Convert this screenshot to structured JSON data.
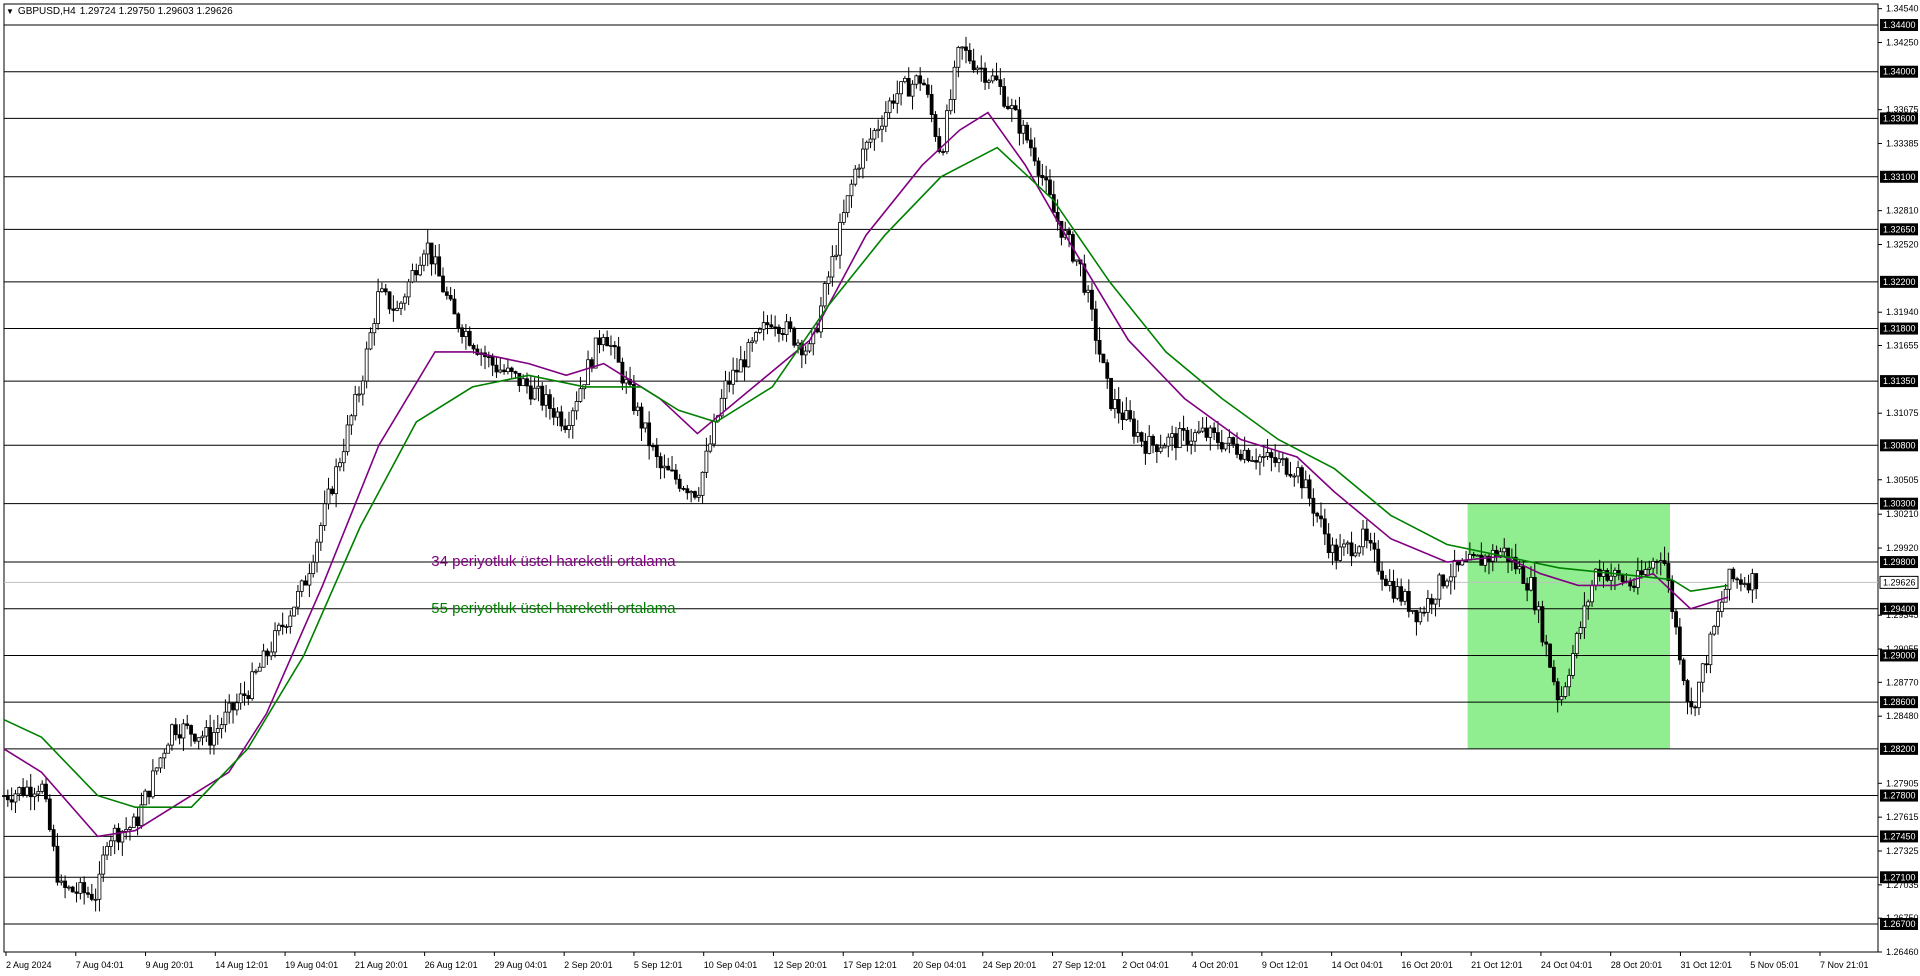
{
  "header": {
    "symbol": "GBPUSD,H4",
    "ohlc": "1.29724 1.29750 1.29603 1.29626"
  },
  "chart_data": {
    "type": "candlestick",
    "ylim": [
      1.2646,
      1.3458
    ],
    "y_ticks": [
      "1.34540",
      "1.34250",
      "1.33675",
      "1.33385",
      "1.32810",
      "1.32520",
      "1.31940",
      "1.31655",
      "1.31075",
      "1.30505",
      "1.30210",
      "1.29920",
      "1.29345",
      "1.29055",
      "1.28770",
      "1.28480",
      "1.27905",
      "1.27615",
      "1.27325",
      "1.27035",
      "1.26750",
      "1.26460"
    ],
    "levels": [
      1.344,
      1.34,
      1.336,
      1.331,
      1.3265,
      1.322,
      1.318,
      1.3135,
      1.308,
      1.303,
      1.298,
      1.294,
      1.29,
      1.286,
      1.282,
      1.278,
      1.2745,
      1.271,
      1.267
    ],
    "level_labels": [
      "1.34400",
      "1.34000",
      "1.33600",
      "1.33100",
      "1.32650",
      "1.32200",
      "1.31800",
      "1.31350",
      "1.30800",
      "1.30300",
      "1.29800",
      "1.29400",
      "1.29000",
      "1.28600",
      "1.28200",
      "1.27800",
      "1.27450",
      "1.27100",
      "1.26700"
    ],
    "current_price": 1.29626,
    "current_price_label": "1.29626",
    "x_labels": [
      "2 Aug 2024",
      "7 Aug 04:01",
      "9 Aug 20:01",
      "14 Aug 12:01",
      "19 Aug 04:01",
      "21 Aug 20:01",
      "26 Aug 12:01",
      "29 Aug 04:01",
      "2 Sep 20:01",
      "5 Sep 12:01",
      "10 Sep 04:01",
      "12 Sep 20:01",
      "17 Sep 12:01",
      "20 Sep 04:01",
      "24 Sep 20:01",
      "27 Sep 12:01",
      "2 Oct 04:01",
      "4 Oct 20:01",
      "9 Oct 12:01",
      "14 Oct 04:01",
      "16 Oct 20:01",
      "21 Oct 12:01",
      "24 Oct 04:01",
      "28 Oct 20:01",
      "31 Oct 12:01",
      "5 Nov 05:01",
      "7 Nov 21:01"
    ],
    "price_path": [
      [
        0,
        1.278
      ],
      [
        0.02,
        1.279
      ],
      [
        0.03,
        1.27
      ],
      [
        0.05,
        1.2695
      ],
      [
        0.055,
        1.2745
      ],
      [
        0.07,
        1.2755
      ],
      [
        0.09,
        1.284
      ],
      [
        0.11,
        1.283
      ],
      [
        0.13,
        1.287
      ],
      [
        0.16,
        1.296
      ],
      [
        0.19,
        1.313
      ],
      [
        0.2,
        1.321
      ],
      [
        0.21,
        1.3195
      ],
      [
        0.225,
        1.3255
      ],
      [
        0.24,
        1.319
      ],
      [
        0.26,
        1.315
      ],
      [
        0.28,
        1.313
      ],
      [
        0.3,
        1.31
      ],
      [
        0.32,
        1.318
      ],
      [
        0.33,
        1.314
      ],
      [
        0.35,
        1.306
      ],
      [
        0.37,
        1.304
      ],
      [
        0.385,
        1.313
      ],
      [
        0.41,
        1.319
      ],
      [
        0.43,
        1.316
      ],
      [
        0.455,
        1.332
      ],
      [
        0.475,
        1.338
      ],
      [
        0.49,
        1.3395
      ],
      [
        0.5,
        1.333
      ],
      [
        0.51,
        1.342
      ],
      [
        0.53,
        1.339
      ],
      [
        0.55,
        1.333
      ],
      [
        0.56,
        1.328
      ],
      [
        0.575,
        1.323
      ],
      [
        0.59,
        1.312
      ],
      [
        0.61,
        1.308
      ],
      [
        0.64,
        1.309
      ],
      [
        0.67,
        1.307
      ],
      [
        0.69,
        1.306
      ],
      [
        0.71,
        1.2985
      ],
      [
        0.725,
        1.3
      ],
      [
        0.74,
        1.296
      ],
      [
        0.755,
        1.2935
      ],
      [
        0.77,
        1.297
      ],
      [
        0.785,
        1.298
      ],
      [
        0.8,
        1.299
      ],
      [
        0.815,
        1.296
      ],
      [
        0.83,
        1.286
      ],
      [
        0.85,
        1.2975
      ],
      [
        0.87,
        1.296
      ],
      [
        0.885,
        1.299
      ],
      [
        0.9,
        1.285
      ],
      [
        0.92,
        1.2965
      ],
      [
        0.935,
        1.2965
      ]
    ],
    "series": [
      {
        "name": "34 periyotluk üstel hareketli ortalama",
        "color": "#800080",
        "points": [
          [
            0,
            1.282
          ],
          [
            0.02,
            1.28
          ],
          [
            0.05,
            1.2745
          ],
          [
            0.07,
            1.275
          ],
          [
            0.09,
            1.277
          ],
          [
            0.12,
            1.28
          ],
          [
            0.14,
            1.285
          ],
          [
            0.17,
            1.296
          ],
          [
            0.2,
            1.308
          ],
          [
            0.23,
            1.316
          ],
          [
            0.25,
            1.316
          ],
          [
            0.28,
            1.315
          ],
          [
            0.3,
            1.314
          ],
          [
            0.32,
            1.315
          ],
          [
            0.35,
            1.312
          ],
          [
            0.37,
            1.309
          ],
          [
            0.4,
            1.313
          ],
          [
            0.43,
            1.317
          ],
          [
            0.46,
            1.326
          ],
          [
            0.49,
            1.332
          ],
          [
            0.51,
            1.335
          ],
          [
            0.525,
            1.3365
          ],
          [
            0.545,
            1.332
          ],
          [
            0.57,
            1.325
          ],
          [
            0.6,
            1.317
          ],
          [
            0.63,
            1.312
          ],
          [
            0.66,
            1.3085
          ],
          [
            0.69,
            1.307
          ],
          [
            0.71,
            1.304
          ],
          [
            0.74,
            1.3
          ],
          [
            0.77,
            1.298
          ],
          [
            0.8,
            1.2985
          ],
          [
            0.82,
            1.297
          ],
          [
            0.84,
            1.296
          ],
          [
            0.86,
            1.296
          ],
          [
            0.88,
            1.297
          ],
          [
            0.9,
            1.294
          ],
          [
            0.92,
            1.295
          ]
        ]
      },
      {
        "name": "55 periyotluk üstel hareketli ortalama",
        "color": "#008000",
        "points": [
          [
            0,
            1.2845
          ],
          [
            0.02,
            1.283
          ],
          [
            0.05,
            1.278
          ],
          [
            0.07,
            1.277
          ],
          [
            0.1,
            1.277
          ],
          [
            0.13,
            1.282
          ],
          [
            0.16,
            1.29
          ],
          [
            0.19,
            1.301
          ],
          [
            0.22,
            1.31
          ],
          [
            0.25,
            1.313
          ],
          [
            0.28,
            1.314
          ],
          [
            0.31,
            1.313
          ],
          [
            0.34,
            1.313
          ],
          [
            0.36,
            1.311
          ],
          [
            0.38,
            1.31
          ],
          [
            0.41,
            1.313
          ],
          [
            0.44,
            1.32
          ],
          [
            0.47,
            1.326
          ],
          [
            0.5,
            1.331
          ],
          [
            0.53,
            1.3335
          ],
          [
            0.56,
            1.329
          ],
          [
            0.59,
            1.322
          ],
          [
            0.62,
            1.316
          ],
          [
            0.65,
            1.312
          ],
          [
            0.68,
            1.3085
          ],
          [
            0.71,
            1.306
          ],
          [
            0.74,
            1.302
          ],
          [
            0.77,
            1.2995
          ],
          [
            0.8,
            1.2985
          ],
          [
            0.83,
            1.2975
          ],
          [
            0.86,
            1.297
          ],
          [
            0.89,
            1.2965
          ],
          [
            0.9,
            1.2955
          ],
          [
            0.92,
            1.296
          ]
        ]
      }
    ],
    "highlight_box": {
      "x_from": 0.781,
      "x_to": 0.889,
      "y_from": 1.282,
      "y_to": 1.303,
      "color": "#90ee90"
    },
    "annotations": [
      {
        "text": "34 periyotluk üstel hareketli ortalama",
        "color": "#800080",
        "x": 0.228,
        "y": 1.298
      },
      {
        "text": "55 periyotluk üstel hareketli ortalama",
        "color": "#008000",
        "x": 0.228,
        "y": 1.294
      }
    ]
  }
}
